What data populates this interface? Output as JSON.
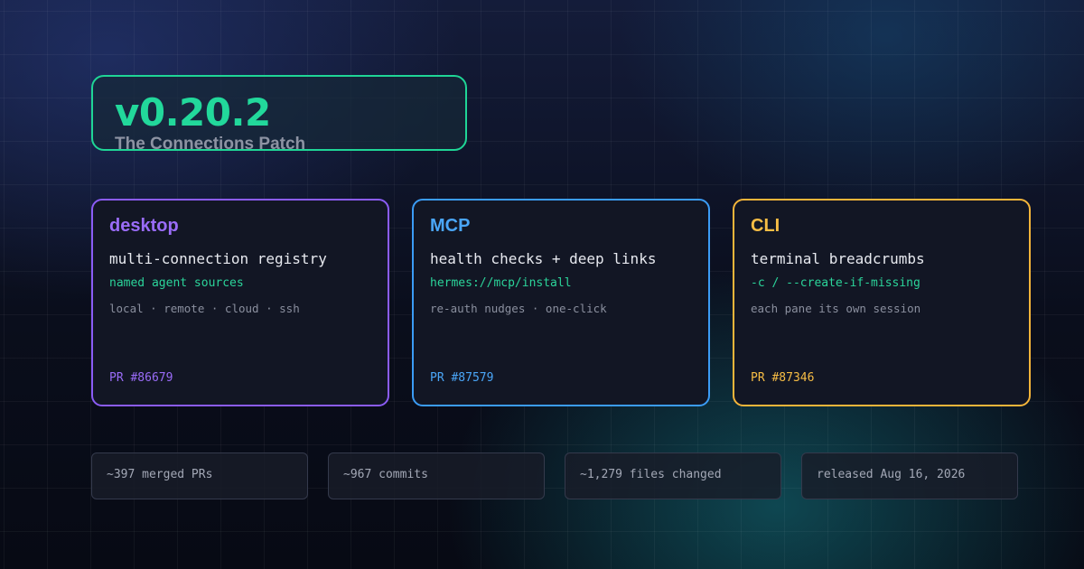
{
  "header": {
    "version": "v0.20.2",
    "patch_name": "The Connections Patch"
  },
  "cards": [
    {
      "title": "desktop",
      "headline": "multi-connection registry",
      "detail": "named agent sources",
      "note": "local · remote · cloud · ssh",
      "pr": "PR #86679",
      "color": "#8b5cf6"
    },
    {
      "title": "MCP",
      "headline": "health checks + deep links",
      "detail": "hermes://mcp/install",
      "note": "re-auth nudges · one-click",
      "pr": "PR #87579",
      "color": "#3b9cf6"
    },
    {
      "title": "CLI",
      "headline": "terminal breadcrumbs",
      "detail": "-c / --create-if-missing",
      "note": "each pane its own session",
      "pr": "PR #87346",
      "color": "#f5b53a"
    }
  ],
  "stats": [
    "~397 merged PRs",
    "~967 commits",
    "~1,279 files changed",
    "released Aug 16, 2026"
  ],
  "colors": {
    "accent_green": "#22d89b",
    "background": "#0b1020"
  }
}
